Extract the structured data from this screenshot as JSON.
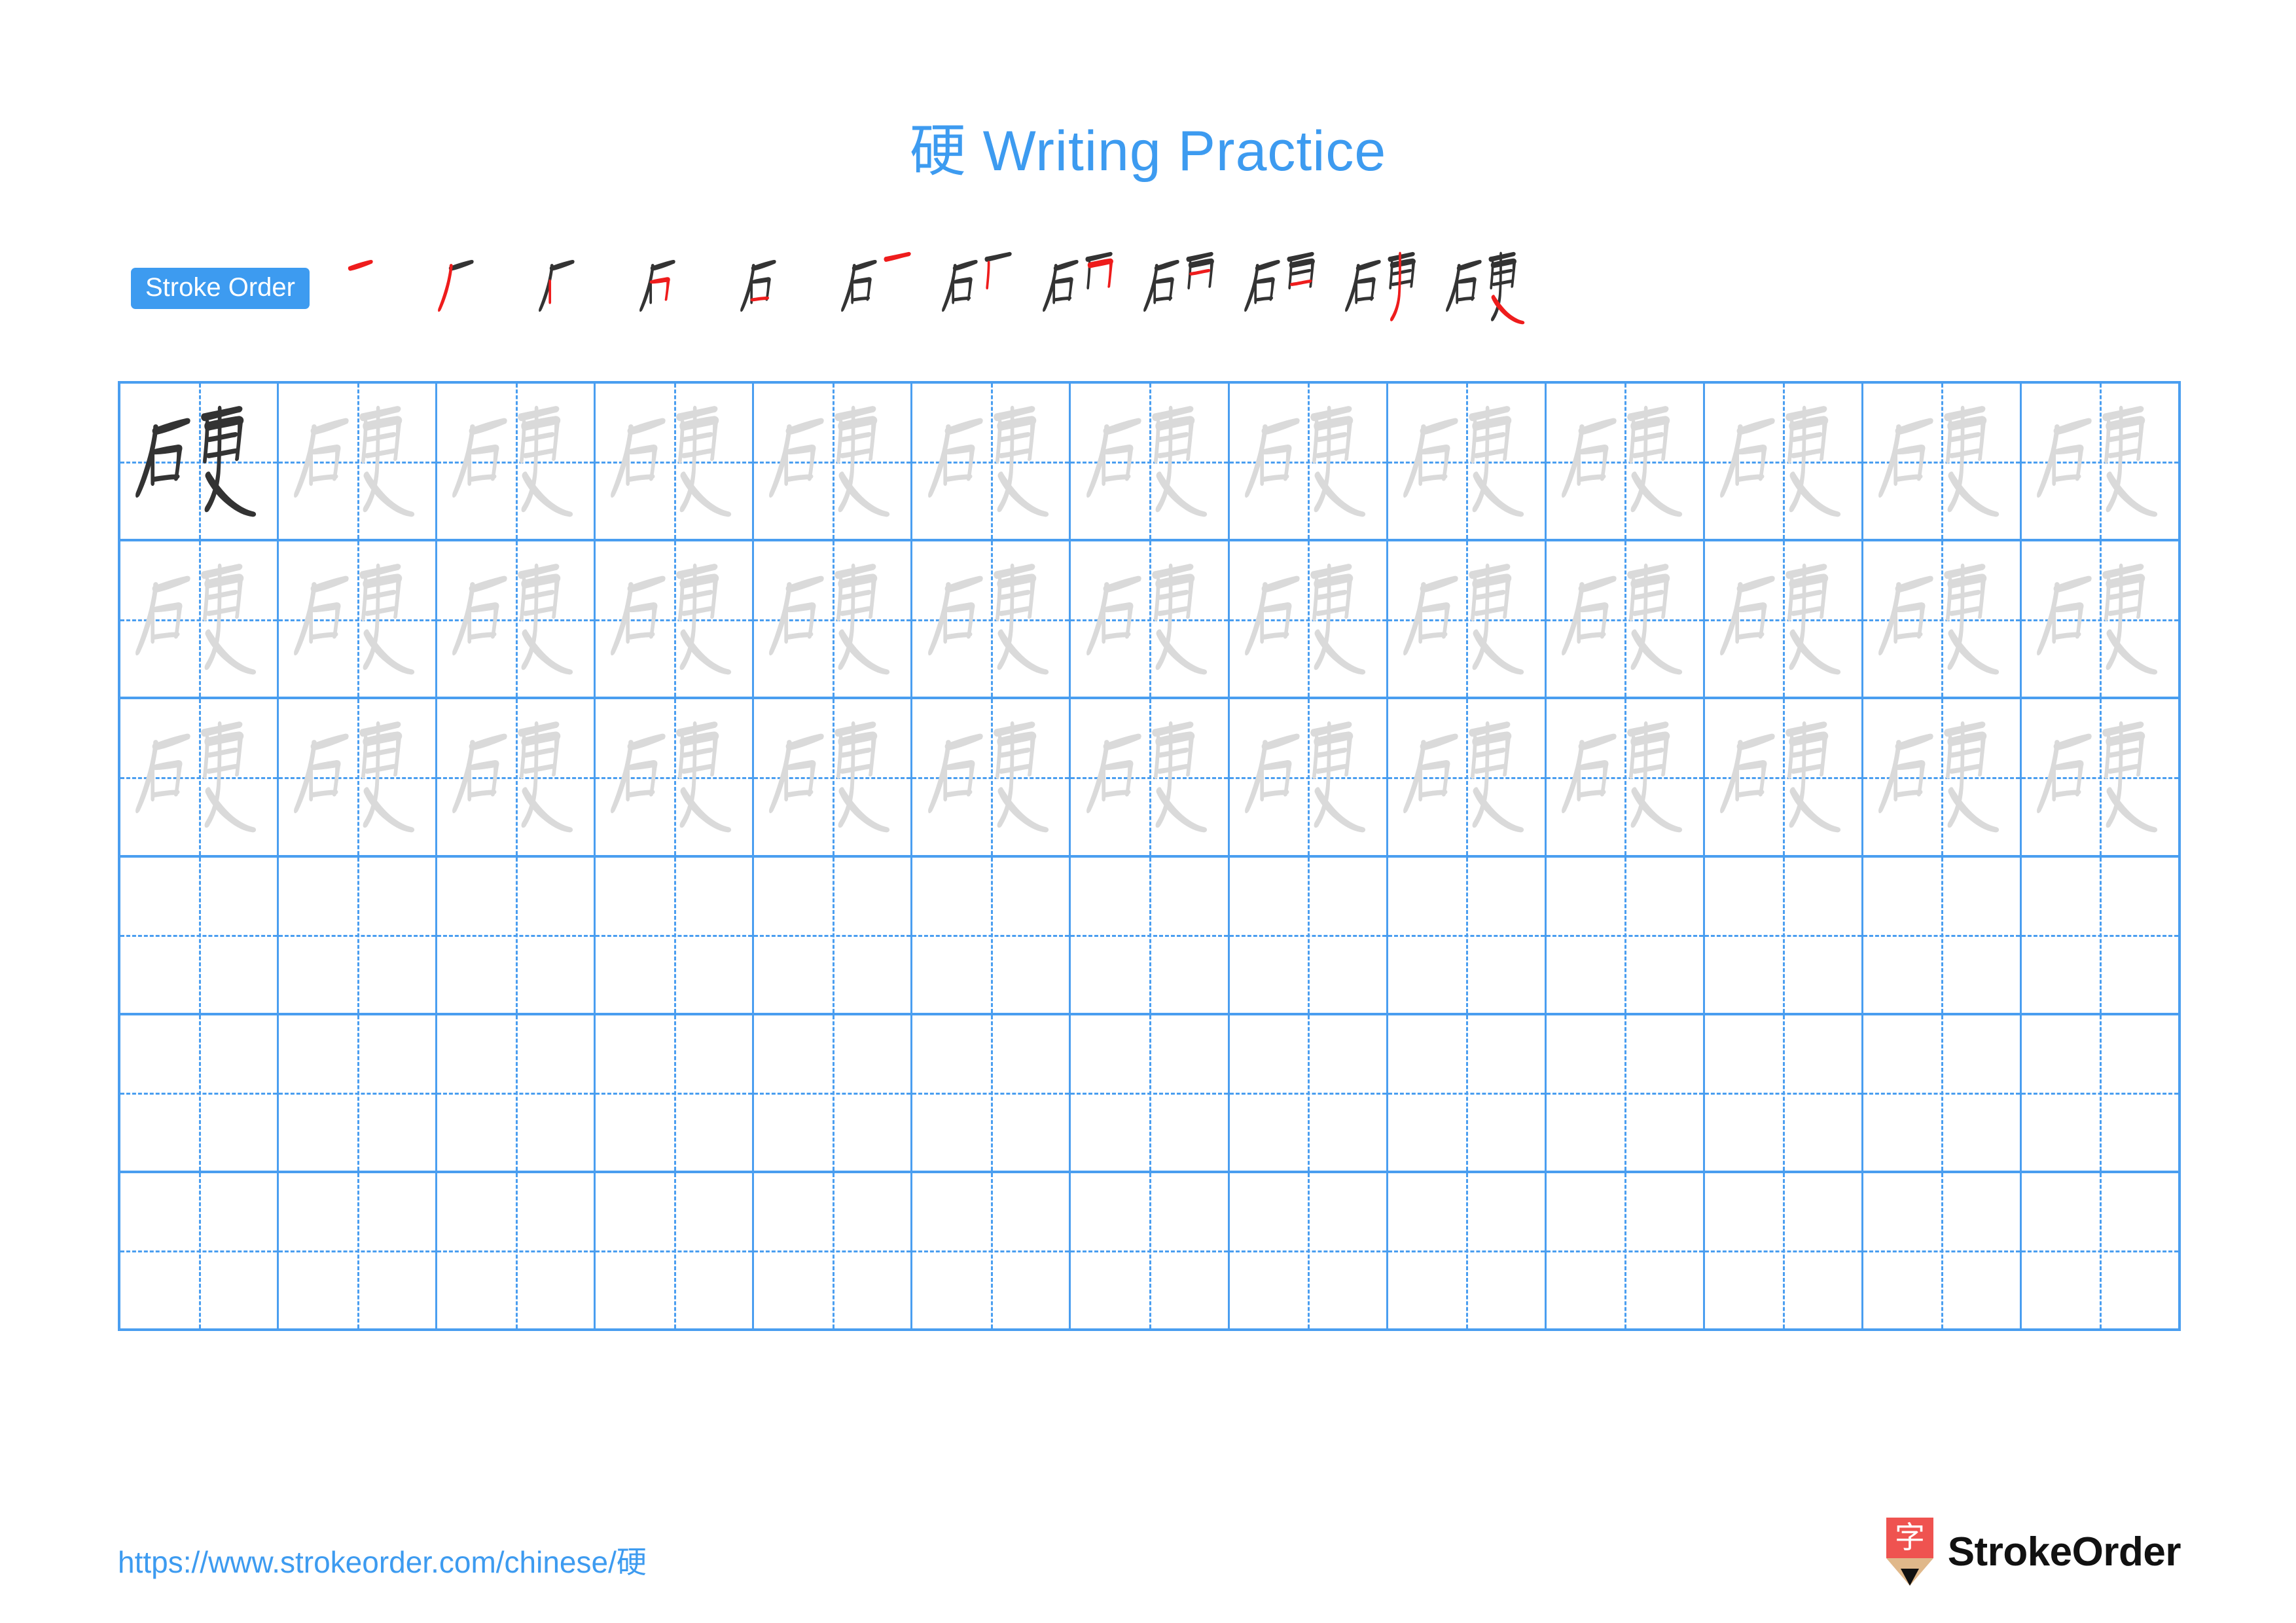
{
  "character": "硬",
  "title": "硬 Writing Practice",
  "colors": {
    "accent_blue": "#3d9bf0",
    "grid_blue": "#4a9ef0",
    "model_char": "#333333",
    "trace_char": "#dadada",
    "new_stroke_red": "#ee1c1c",
    "logo_red": "#ef5350",
    "logo_wood": "#e0b88a",
    "logo_tip": "#111111"
  },
  "stroke_order": {
    "badge_label": "Stroke Order",
    "total_strokes": 12,
    "steps": [
      {
        "index": 1,
        "label": "stroke-step-1"
      },
      {
        "index": 2,
        "label": "stroke-step-2"
      },
      {
        "index": 3,
        "label": "stroke-step-3"
      },
      {
        "index": 4,
        "label": "stroke-step-4"
      },
      {
        "index": 5,
        "label": "stroke-step-5"
      },
      {
        "index": 6,
        "label": "stroke-step-6"
      },
      {
        "index": 7,
        "label": "stroke-step-7"
      },
      {
        "index": 8,
        "label": "stroke-step-8"
      },
      {
        "index": 9,
        "label": "stroke-step-9"
      },
      {
        "index": 10,
        "label": "stroke-step-10"
      },
      {
        "index": 11,
        "label": "stroke-step-11"
      },
      {
        "index": 12,
        "label": "stroke-step-12"
      }
    ]
  },
  "grid": {
    "columns": 13,
    "rows": 6,
    "rows_data": [
      {
        "row": 1,
        "cells": [
          "model",
          "trace",
          "trace",
          "trace",
          "trace",
          "trace",
          "trace",
          "trace",
          "trace",
          "trace",
          "trace",
          "trace",
          "trace"
        ]
      },
      {
        "row": 2,
        "cells": [
          "trace",
          "trace",
          "trace",
          "trace",
          "trace",
          "trace",
          "trace",
          "trace",
          "trace",
          "trace",
          "trace",
          "trace",
          "trace"
        ]
      },
      {
        "row": 3,
        "cells": [
          "trace",
          "trace",
          "trace",
          "trace",
          "trace",
          "trace",
          "trace",
          "trace",
          "trace",
          "trace",
          "trace",
          "trace",
          "trace"
        ]
      },
      {
        "row": 4,
        "cells": [
          "empty",
          "empty",
          "empty",
          "empty",
          "empty",
          "empty",
          "empty",
          "empty",
          "empty",
          "empty",
          "empty",
          "empty",
          "empty"
        ]
      },
      {
        "row": 5,
        "cells": [
          "empty",
          "empty",
          "empty",
          "empty",
          "empty",
          "empty",
          "empty",
          "empty",
          "empty",
          "empty",
          "empty",
          "empty",
          "empty"
        ]
      },
      {
        "row": 6,
        "cells": [
          "empty",
          "empty",
          "empty",
          "empty",
          "empty",
          "empty",
          "empty",
          "empty",
          "empty",
          "empty",
          "empty",
          "empty",
          "empty"
        ]
      }
    ]
  },
  "footer": {
    "url": "https://www.strokeorder.com/chinese/硬",
    "brand_name": "StrokeOrder",
    "logo_glyph": "字"
  }
}
